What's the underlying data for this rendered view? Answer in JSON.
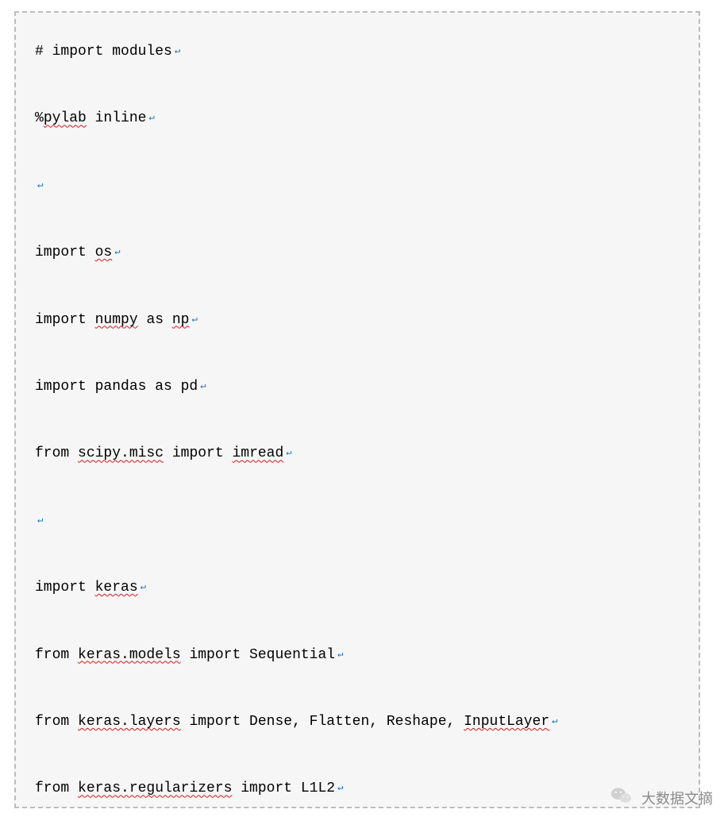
{
  "paragraph_mark": "↵",
  "lines": [
    {
      "kind": "code",
      "segments": [
        {
          "t": "# import modules",
          "squig": false
        }
      ]
    },
    {
      "kind": "code",
      "segments": [
        {
          "t": "%",
          "squig": false
        },
        {
          "t": "pylab",
          "squig": true
        },
        {
          "t": " inline",
          "squig": false
        }
      ]
    },
    {
      "kind": "blank"
    },
    {
      "kind": "code",
      "segments": [
        {
          "t": "import ",
          "squig": false
        },
        {
          "t": "os",
          "squig": true
        }
      ]
    },
    {
      "kind": "code",
      "segments": [
        {
          "t": "import ",
          "squig": false
        },
        {
          "t": "numpy",
          "squig": true
        },
        {
          "t": " as ",
          "squig": false
        },
        {
          "t": "np",
          "squig": true
        }
      ]
    },
    {
      "kind": "code",
      "segments": [
        {
          "t": "import pandas as pd",
          "squig": false
        }
      ]
    },
    {
      "kind": "code",
      "segments": [
        {
          "t": "from ",
          "squig": false
        },
        {
          "t": "scipy.misc",
          "squig": true
        },
        {
          "t": " import ",
          "squig": false
        },
        {
          "t": "imread",
          "squig": true
        }
      ]
    },
    {
      "kind": "blank"
    },
    {
      "kind": "code",
      "segments": [
        {
          "t": "import ",
          "squig": false
        },
        {
          "t": "keras",
          "squig": true
        }
      ]
    },
    {
      "kind": "code",
      "segments": [
        {
          "t": "from ",
          "squig": false
        },
        {
          "t": "keras.models",
          "squig": true
        },
        {
          "t": " import Sequential",
          "squig": false
        }
      ]
    },
    {
      "kind": "code",
      "segments": [
        {
          "t": "from ",
          "squig": false
        },
        {
          "t": "keras.layers",
          "squig": true
        },
        {
          "t": " import Dense, Flatten, Reshape, ",
          "squig": false
        },
        {
          "t": "InputLayer",
          "squig": true
        }
      ]
    },
    {
      "kind": "code",
      "segments": [
        {
          "t": "from ",
          "squig": false
        },
        {
          "t": "keras.regularizers",
          "squig": true
        },
        {
          "t": " import L1L2",
          "squig": false
        }
      ]
    }
  ],
  "watermark_text": "大数据文摘"
}
